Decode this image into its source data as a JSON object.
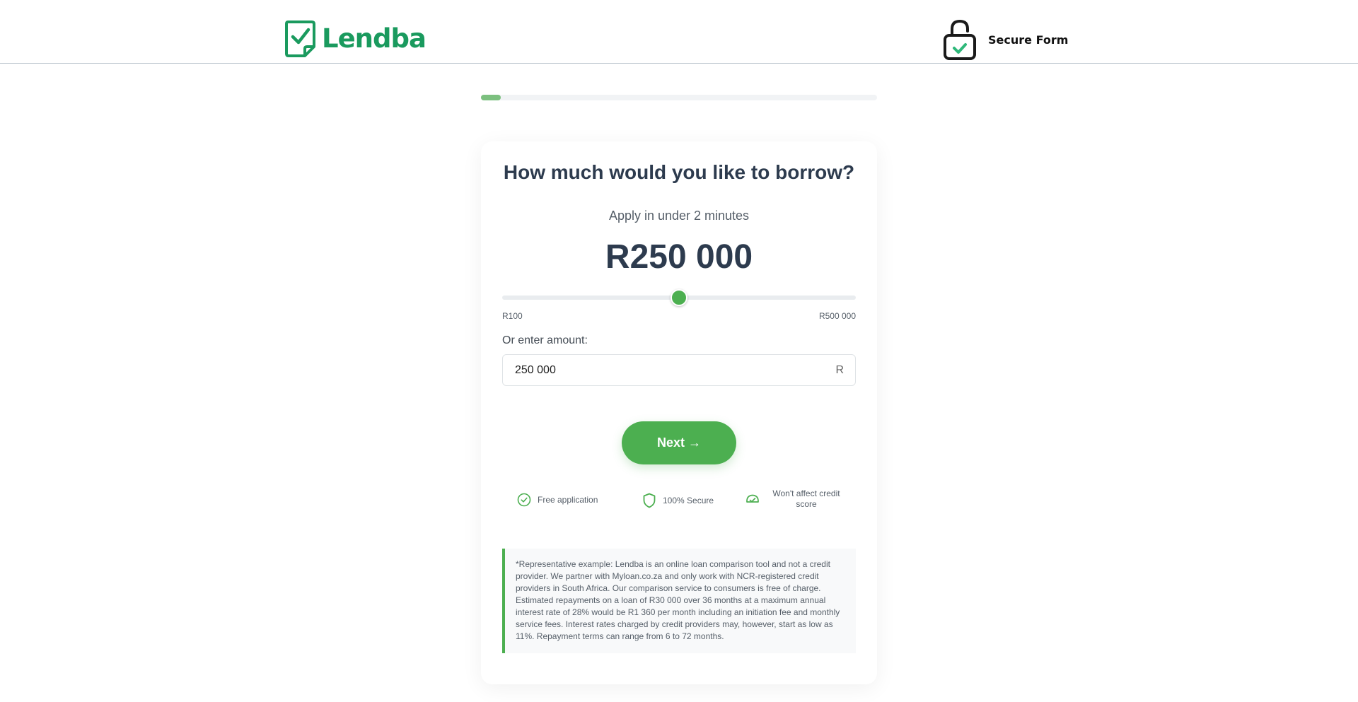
{
  "header": {
    "brand": "Lendba",
    "secure_label": "Secure Form"
  },
  "progress": {
    "fraction": 0.05
  },
  "form": {
    "title": "How much would you like to borrow?",
    "subtitle": "Apply in under 2 minutes",
    "amount_display": "R250 000",
    "slider": {
      "min_label": "R100",
      "max_label": "R500 000",
      "min": 100,
      "max": 500000,
      "value": 250000
    },
    "input_label": "Or enter amount:",
    "input_value": "250 000",
    "currency_suffix": "R",
    "next_label": "Next →"
  },
  "features": [
    {
      "icon": "check-circle-icon",
      "label": "Free application"
    },
    {
      "icon": "shield-icon",
      "label": "100% Secure"
    },
    {
      "icon": "gauge-icon",
      "label": "Won't affect credit score"
    }
  ],
  "disclaimer": "*Representative example: Lendba is an online loan comparison tool and not a credit provider. We partner with Myloan.co.za and only work with NCR-registered credit providers in South Africa. Our comparison service to consumers is free of charge. Estimated repayments on a loan of R30 000 over 36 months at a maximum annual interest rate of 28% would be R1 360 per month including an initiation fee and monthly service fees. Interest rates charged by credit providers may, however, start as low as 11%. Repayment terms can range from 6 to 72 months.",
  "colors": {
    "brand": "#1a9a5e",
    "accent": "#4caf50",
    "text": "#2d3b4e"
  }
}
